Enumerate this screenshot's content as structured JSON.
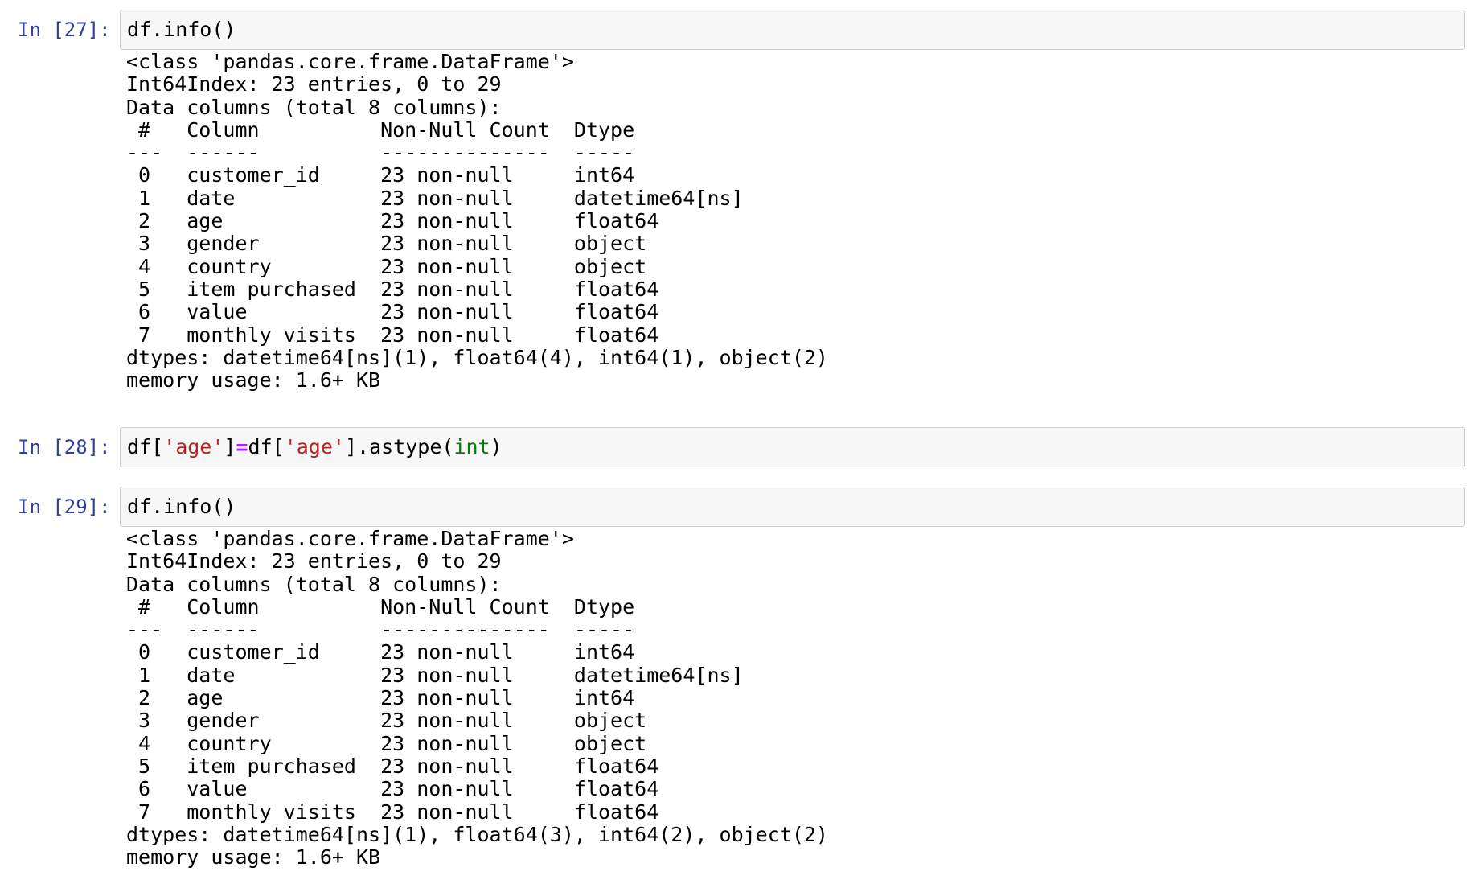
{
  "cells": [
    {
      "prompt": "In [27]:",
      "code": "df.info()",
      "output": "<class 'pandas.core.frame.DataFrame'>\nInt64Index: 23 entries, 0 to 29\nData columns (total 8 columns):\n #   Column          Non-Null Count  Dtype         \n---  ------          --------------  -----         \n 0   customer_id     23 non-null     int64         \n 1   date            23 non-null     datetime64[ns]\n 2   age             23 non-null     float64       \n 3   gender          23 non-null     object        \n 4   country         23 non-null     object        \n 5   item purchased  23 non-null     float64       \n 6   value           23 non-null     float64       \n 7   monthly visits  23 non-null     float64       \ndtypes: datetime64[ns](1), float64(4), int64(1), object(2)\nmemory usage: 1.6+ KB"
    },
    {
      "prompt": "In [28]:",
      "code_tokens": {
        "t1": "df[",
        "t2": "'age'",
        "t3": "]",
        "t4": "=",
        "t5": "df[",
        "t6": "'age'",
        "t7": "].astype(",
        "t8": "int",
        "t9": ")"
      }
    },
    {
      "prompt": "In [29]:",
      "code": "df.info()",
      "output": "<class 'pandas.core.frame.DataFrame'>\nInt64Index: 23 entries, 0 to 29\nData columns (total 8 columns):\n #   Column          Non-Null Count  Dtype         \n---  ------          --------------  -----         \n 0   customer_id     23 non-null     int64         \n 1   date            23 non-null     datetime64[ns]\n 2   age             23 non-null     int64         \n 3   gender          23 non-null     object        \n 4   country         23 non-null     object        \n 5   item purchased  23 non-null     float64       \n 6   value           23 non-null     float64       \n 7   monthly visits  23 non-null     float64       \ndtypes: datetime64[ns](1), float64(3), int64(2), object(2)\nmemory usage: 1.6+ KB"
    }
  ],
  "colors": {
    "prompt": "#303f9f",
    "string": "#ba2121",
    "operator": "#aa22ff",
    "builtin": "#008000",
    "input_bg": "#f7f7f7",
    "input_border": "#cfcfcf"
  }
}
